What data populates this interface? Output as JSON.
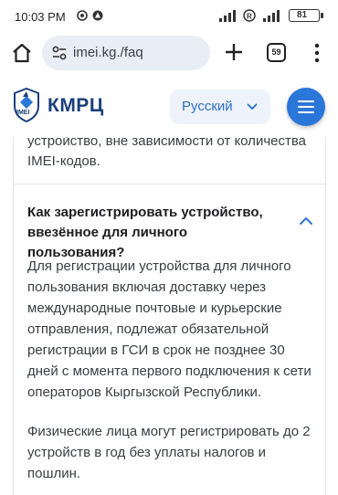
{
  "status_bar": {
    "time": "10:03 PM",
    "battery": "81"
  },
  "browser": {
    "url": "imei.kg./faq",
    "tab_count": "59"
  },
  "site": {
    "logo_text": "КМРЦ",
    "logo_badge": "IMEI",
    "language": "Русский"
  },
  "faq": {
    "previous_answer_tail": "устройство, вне зависимости от количества IMEI-кодов.",
    "question": "Как зарегистрировать устройство, ввезённое для личного пользования?",
    "answer_paragraphs": [
      "Для регистрации устройства для личного пользования включая доставку через международные почтовые и курьерские отправления, подлежат обязательной регистрации в ГСИ в срок не позднее 30 дней с момента первого подключения к сети операторов Кыргызской Республики.",
      "Физические лица могут регистрировать до 2 устройств в год без уплаты налогов и пошлин."
    ]
  },
  "colors": {
    "brand_blue": "#2b76d9",
    "logo_navy": "#1a3f7a",
    "link_blue": "#2c6fc4"
  }
}
